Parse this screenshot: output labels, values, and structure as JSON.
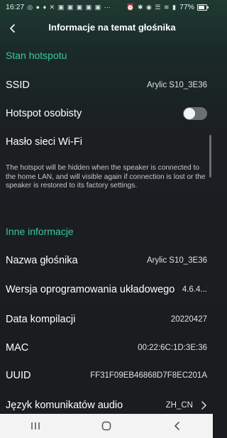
{
  "status_bar": {
    "time": "16:27",
    "battery_percent": "77%",
    "battery_level": 0.77
  },
  "header": {
    "title": "Informacje na temat głośnika",
    "back_icon": "chevron-left-icon"
  },
  "hotspot_section": {
    "heading": "Stan hotspotu",
    "ssid_label": "SSID",
    "ssid_value": "Arylic S10_3E36",
    "private_hotspot_label": "Hotspot osobisty",
    "private_hotspot_on": false,
    "wifi_password_label": "Hasło sieci Wi-Fi",
    "description": "The hotspot will be hidden when the speaker is connected to the home LAN, and will visible again if connection is lost or the speaker is restored to its factory settings."
  },
  "other_section": {
    "heading": "Inne informacje",
    "rows": [
      {
        "label": "Nazwa głośnika",
        "value": "Arylic S10_3E36"
      },
      {
        "label": "Wersja oprogramowania układowego",
        "value": "4.6.4..."
      },
      {
        "label": "Data kompilacji",
        "value": "20220427"
      },
      {
        "label": "MAC",
        "value": "00:22:6C:1D:3E:36"
      },
      {
        "label": "UUID",
        "value": "FF31F09EB46868D7F8EC201A"
      },
      {
        "label": "Język komunikatów audio",
        "value": "ZH_CN"
      }
    ]
  },
  "colors": {
    "accent": "#38c89f",
    "background": "#1a1c1f",
    "navbar": "#f3f3f3"
  }
}
